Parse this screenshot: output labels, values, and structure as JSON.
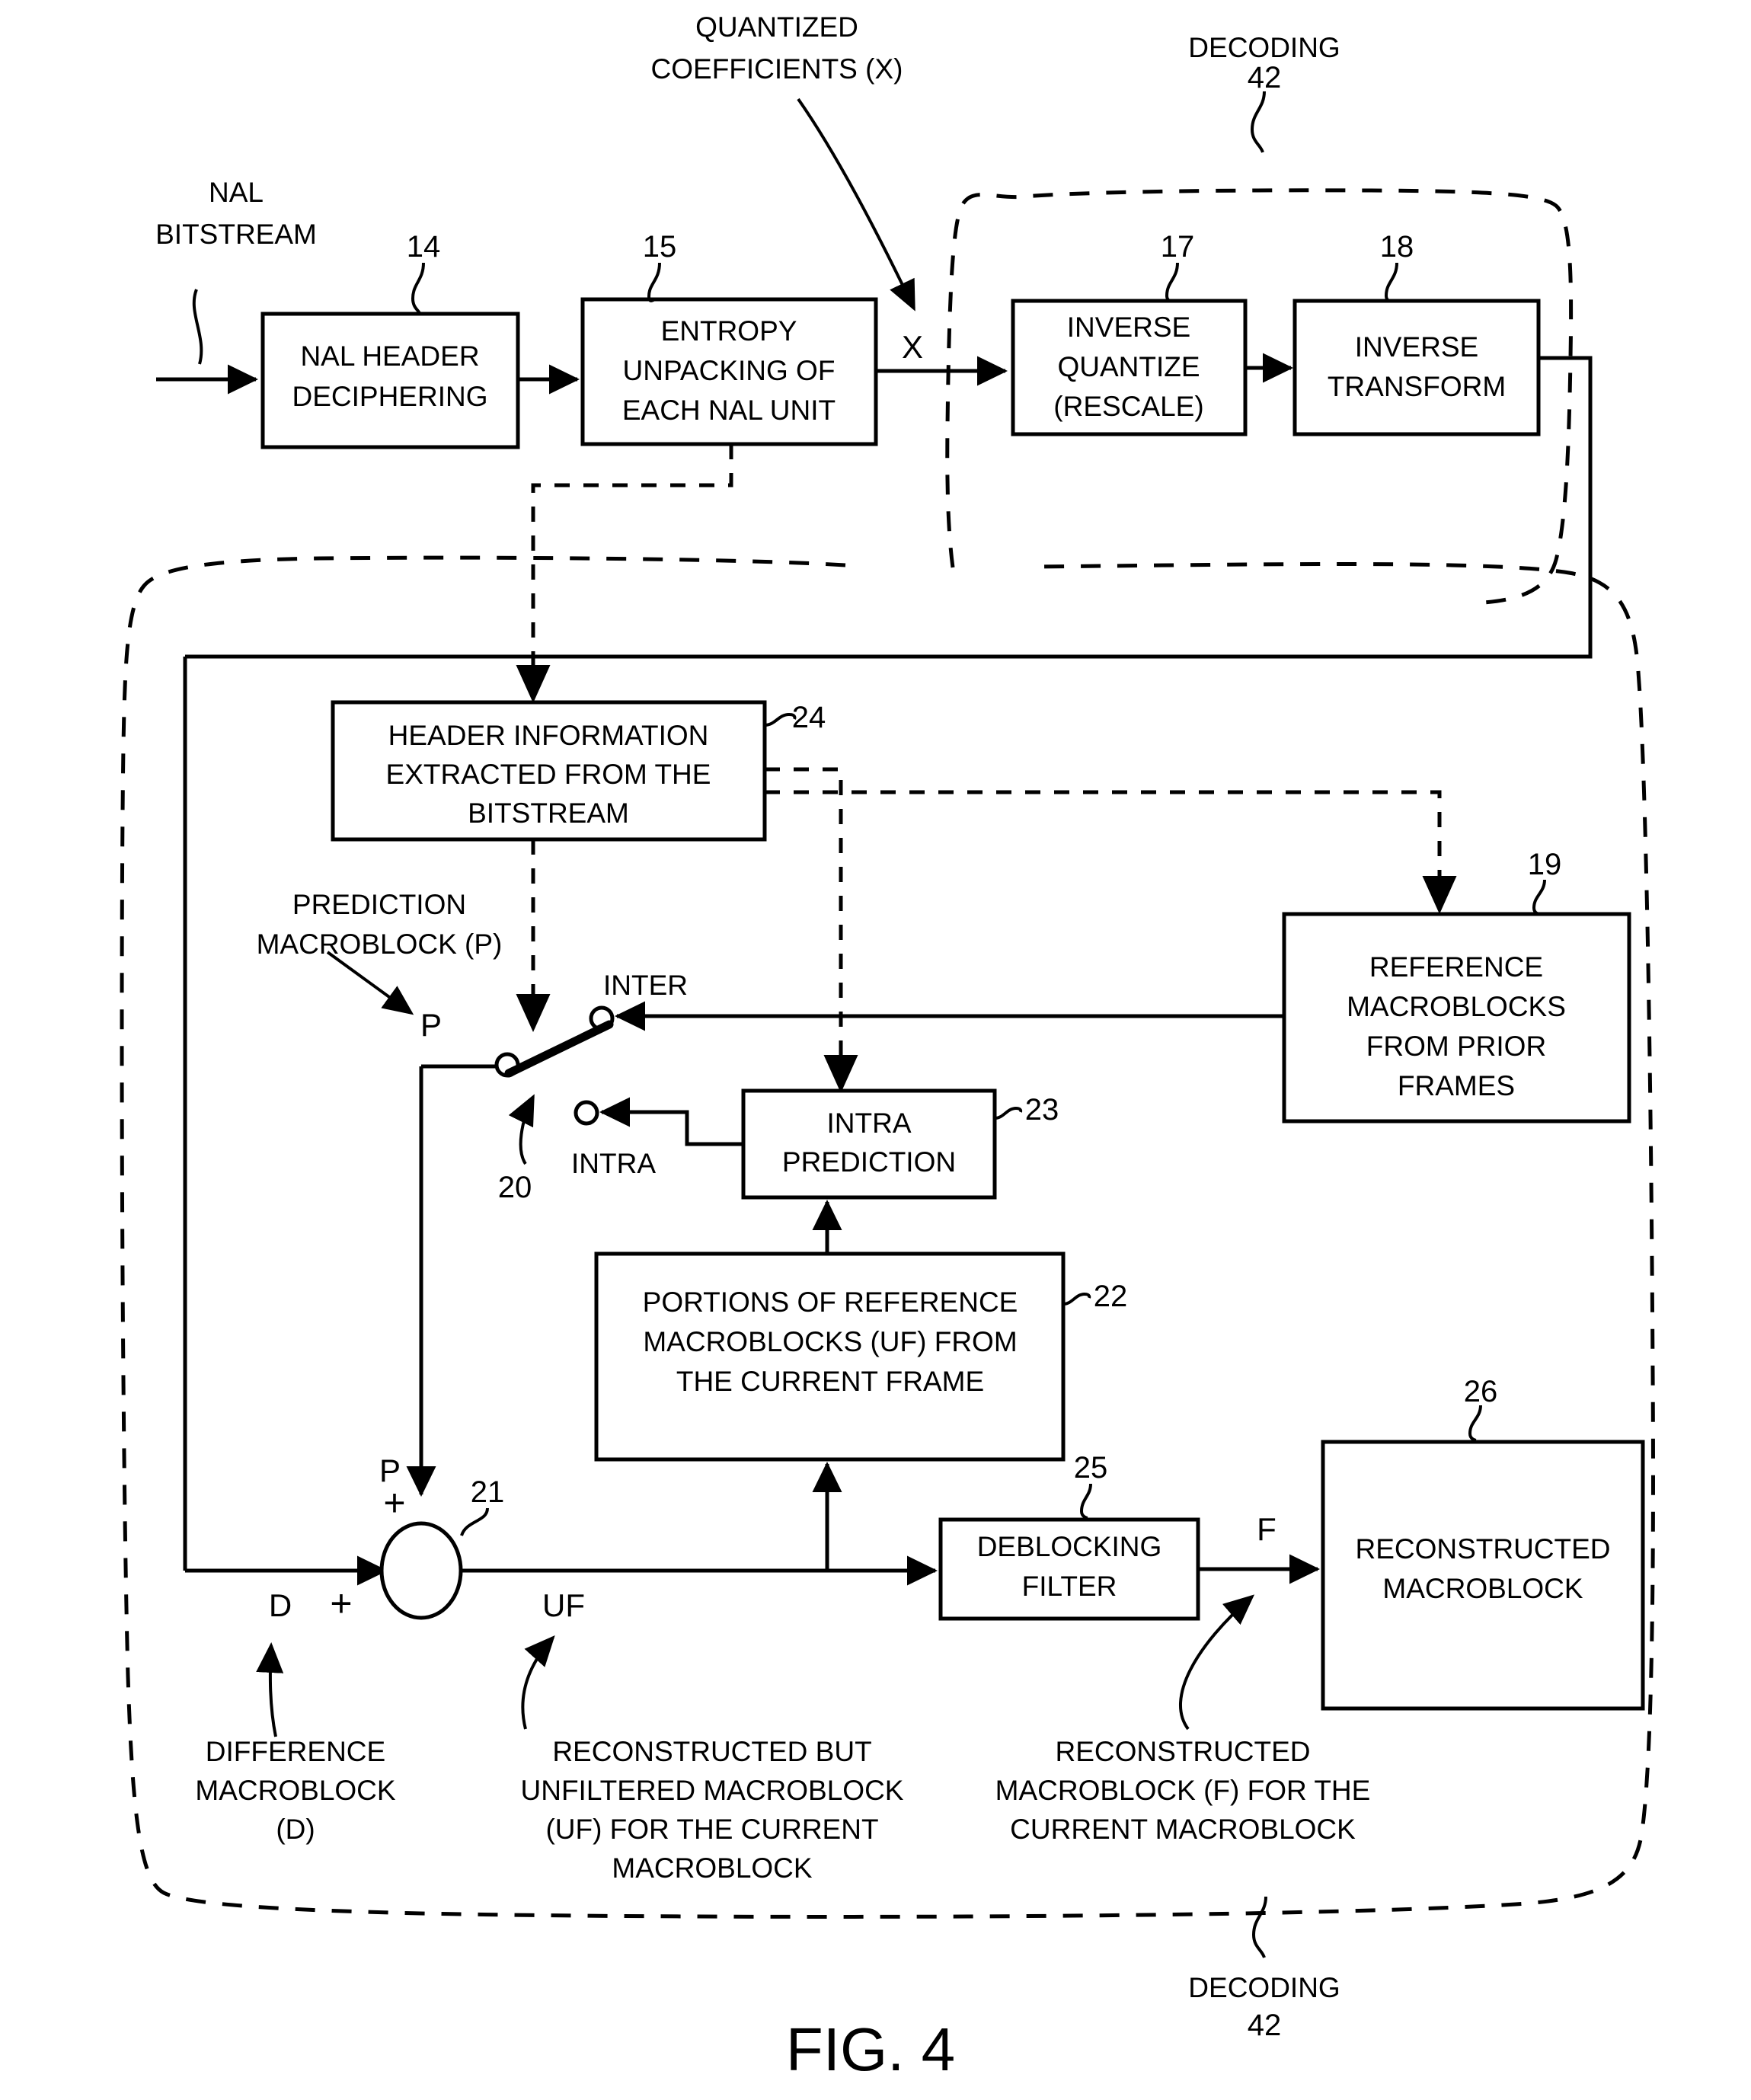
{
  "figure": {
    "title": "FIG. 4",
    "top_region_label": {
      "name": "DECODING",
      "number": "42"
    },
    "bottom_region_label": {
      "name": "DECODING",
      "number": "42"
    }
  },
  "blocks": [
    {
      "id": "nal_header",
      "ref": "14",
      "lines": [
        "NAL HEADER",
        "DECIPHERING"
      ]
    },
    {
      "id": "entropy_unpack",
      "ref": "15",
      "lines": [
        "ENTROPY",
        "UNPACKING OF",
        "EACH NAL UNIT"
      ]
    },
    {
      "id": "inverse_quantize",
      "ref": "17",
      "lines": [
        "INVERSE",
        "QUANTIZE",
        "(RESCALE)"
      ]
    },
    {
      "id": "inverse_transform",
      "ref": "18",
      "lines": [
        "INVERSE",
        "TRANSFORM"
      ]
    },
    {
      "id": "header_info",
      "ref": "24",
      "lines": [
        "HEADER INFORMATION",
        "EXTRACTED FROM THE",
        "BITSTREAM"
      ]
    },
    {
      "id": "reference_macroblocks",
      "ref": "19",
      "lines": [
        "REFERENCE",
        "MACROBLOCKS",
        "FROM PRIOR",
        "FRAMES"
      ]
    },
    {
      "id": "intra_prediction",
      "ref": "23",
      "lines": [
        "INTRA",
        "PREDICTION"
      ]
    },
    {
      "id": "portions_reference",
      "ref": "22",
      "lines": [
        "PORTIONS OF REFERENCE",
        "MACROBLOCKS (UF) FROM",
        "THE CURRENT  FRAME"
      ]
    },
    {
      "id": "deblocking_filter",
      "ref": "25",
      "lines": [
        "DEBLOCKING",
        "FILTER"
      ]
    },
    {
      "id": "reconstructed_macroblock",
      "ref": "26",
      "lines": [
        "RECONSTRUCTED",
        "MACROBLOCK"
      ]
    }
  ],
  "annotations": {
    "quantized_coefficients": [
      "QUANTIZED",
      "COEFFICIENTS (X)"
    ],
    "nal_bitstream": [
      "NAL",
      "BITSTREAM"
    ],
    "prediction_macroblock": [
      "PREDICTION",
      "MACROBLOCK (P)"
    ],
    "difference_macroblock": [
      "DIFFERENCE",
      "MACROBLOCK",
      "(D)"
    ],
    "unfiltered_macroblock": [
      "RECONSTRUCTED BUT",
      "UNFILTERED MACROBLOCK",
      "(UF) FOR THE CURRENT",
      "MACROBLOCK"
    ],
    "reconstructed_f": [
      "RECONSTRUCTED",
      "MACROBLOCK (F) FOR THE",
      "CURRENT MACROBLOCK"
    ]
  },
  "switch": {
    "ref": "20",
    "pole_inter": "INTER",
    "pole_intra": "INTRA"
  },
  "adder": {
    "ref": "21",
    "plus_top": "+",
    "plus_left": "+"
  },
  "signals": {
    "x": "X",
    "p_switch": "P",
    "p_adder": "P",
    "d": "D",
    "uf": "UF",
    "f": "F"
  },
  "colors": {
    "ink": "#000000",
    "paper": "#ffffff"
  }
}
